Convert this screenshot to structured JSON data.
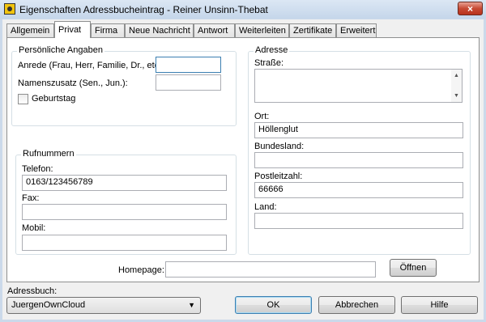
{
  "window": {
    "title": "Eigenschaften Adressbucheintrag - Reiner Unsinn-Thebat",
    "close_label": "×"
  },
  "tabs": [
    {
      "label": "Allgemein"
    },
    {
      "label": "Privat"
    },
    {
      "label": "Firma"
    },
    {
      "label": "Neue Nachricht"
    },
    {
      "label": "Antwort"
    },
    {
      "label": "Weiterleiten"
    },
    {
      "label": "Zertifikate"
    },
    {
      "label": "Erweitert"
    }
  ],
  "personal": {
    "group_label": "Persönliche Angaben",
    "salutation_label": "Anrede (Frau, Herr, Familie, Dr., etc.):",
    "salutation_value": "",
    "suffix_label": "Namenszusatz (Sen., Jun.):",
    "suffix_value": "",
    "birthday_label": "Geburtstag"
  },
  "phones": {
    "group_label": "Rufnummern",
    "phone_label": "Telefon:",
    "phone_value": "0163/123456789",
    "fax_label": "Fax:",
    "fax_value": "",
    "mobile_label": "Mobil:",
    "mobile_value": ""
  },
  "address": {
    "group_label": "Adresse",
    "street_label": "Straße:",
    "city_label": "Ort:",
    "city_value": "Höllenglut",
    "state_label": "Bundesland:",
    "state_value": "",
    "zip_label": "Postleitzahl:",
    "zip_value": "66666",
    "country_label": "Land:",
    "country_value": ""
  },
  "homepage": {
    "label": "Homepage:",
    "value": "",
    "open_label": "Öffnen"
  },
  "footer": {
    "addressbook_label": "Adressbuch:",
    "addressbook_value": "JuergenOwnCloud",
    "ok_label": "OK",
    "cancel_label": "Abbrechen",
    "help_label": "Hilfe"
  }
}
